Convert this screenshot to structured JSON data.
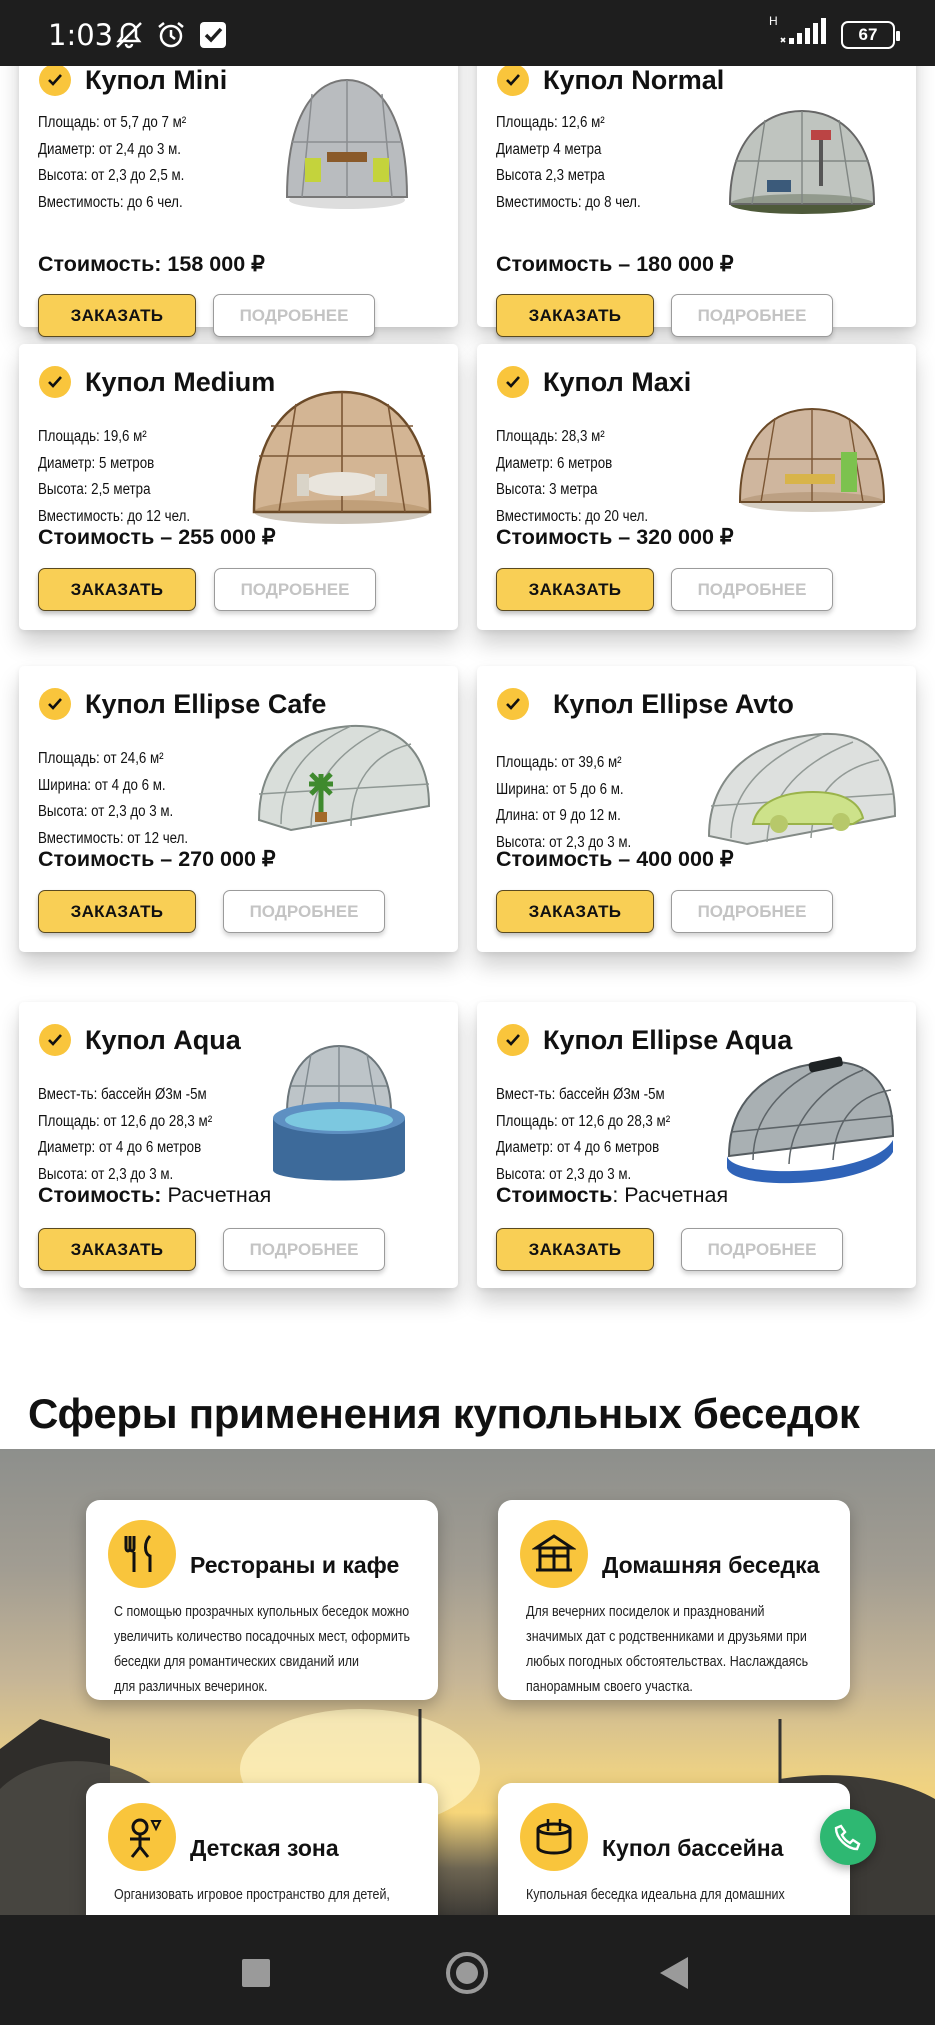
{
  "status_bar": {
    "time": "1:03",
    "network_label": "H",
    "battery": "67",
    "icons": [
      "mute-icon",
      "alarm-icon",
      "checkbox-icon",
      "signal-icon",
      "battery-icon"
    ]
  },
  "products": [
    {
      "title": "Купол Mini",
      "specs": [
        "Площадь: от 5,7 до 7 м²",
        "Диаметр: от 2,4 до 3 м.",
        "Высота: от 2,3 до 2,5 м.",
        "Вместимость: до 6 чел."
      ],
      "price": "Стоимость: 158 000 ₽",
      "order": "ЗАКАЗАТЬ",
      "more": "ПОДРОБНЕЕ"
    },
    {
      "title": "Купол Normal",
      "specs": [
        "Площадь: 12,6 м²",
        "Диаметр 4 метра",
        "Высота 2,3 метра",
        "Вместимость: до 8 чел."
      ],
      "price": "Стоимость – 180 000 ₽",
      "order": "ЗАКАЗАТЬ",
      "more": "ПОДРОБНЕЕ"
    },
    {
      "title": "Купол Medium",
      "specs": [
        "Площадь: 19,6 м²",
        "Диаметр: 5 метров",
        "Высота: 2,5 метра",
        "Вместимость: до 12 чел."
      ],
      "price": "Стоимость – 255 000 ₽",
      "order": "ЗАКАЗАТЬ",
      "more": "ПОДРОБНЕЕ"
    },
    {
      "title": "Купол Maxi",
      "specs": [
        "Площадь: 28,3 м²",
        "Диаметр: 6 метров",
        "Высота: 3 метра",
        "Вместимость: до 20 чел."
      ],
      "price": "Стоимость – 320 000 ₽",
      "order": "ЗАКАЗАТЬ",
      "more": "ПОДРОБНЕЕ"
    },
    {
      "title": "Купол Ellipse Cafe",
      "specs": [
        "Площадь: от 24,6 м²",
        "Ширина: от 4 до 6 м.",
        "Высота: от 2,3 до 3 м.",
        "Вместимость: от 12 чел."
      ],
      "price": "Стоимость – 270 000 ₽",
      "order": "ЗАКАЗАТЬ",
      "more": "ПОДРОБНЕЕ"
    },
    {
      "title": "Купол Ellipse Avto",
      "specs": [
        "Площадь: от 39,6 м²",
        "Ширина: от 5 до 6 м.",
        "Длина: от 9 до 12 м.",
        "Высота: от 2,3 до 3 м."
      ],
      "price": "Стоимость – 400 000 ₽",
      "order": "ЗАКАЗАТЬ",
      "more": "ПОДРОБНЕЕ"
    },
    {
      "title": "Купол Aqua",
      "specs": [
        "Вмест-ть: бассейн Ø3м -5м",
        "Площадь: от 12,6 до 28,3 м²",
        "Диаметр: от 4 до 6 метров",
        "Высота: от 2,3 до 3 м."
      ],
      "price_label": "Стоимость: ",
      "price_value": "Расчетная",
      "order": "ЗАКАЗАТЬ",
      "more": "ПОДРОБНЕЕ"
    },
    {
      "title": "Купол Ellipse Aqua",
      "specs": [
        "Вмест-ть: бассейн Ø3м -5м",
        "Площадь: от 12,6 до 28,3 м²",
        "Диаметр: от 4 до 6 метров",
        "Высота: от 2,3 до 3 м."
      ],
      "price_label": "Стоимость",
      "price_value": ": Расчетная",
      "order": "ЗАКАЗАТЬ",
      "more": "ПОДРОБНЕЕ"
    }
  ],
  "applications": {
    "title": "Сферы применения купольных беседок",
    "items": [
      {
        "title": "Рестораны и кафе",
        "icon": "fork-knife-icon",
        "lines": [
          "С помощью прозрачных купольных беседок можно",
          "увеличить количество посадочных мест, оформить",
          "беседки для романтических свиданий или",
          "для различных вечеринок."
        ]
      },
      {
        "title": "Домашняя беседка",
        "icon": "gazebo-icon",
        "lines": [
          "Для вечерних посиделок и празднований",
          "значимых дат с родственниками и друзьями при",
          "любых погодных обстоятельствах. Наслаждаясь",
          "панорамным своего участка."
        ]
      },
      {
        "title": "Детская зона",
        "icon": "child-icon",
        "lines": [
          "Организовать игровое пространство для детей,"
        ]
      },
      {
        "title": "Купол бассейна",
        "icon": "pool-icon",
        "lines": [
          "Купольная беседка идеальна для домашних"
        ]
      }
    ]
  }
}
